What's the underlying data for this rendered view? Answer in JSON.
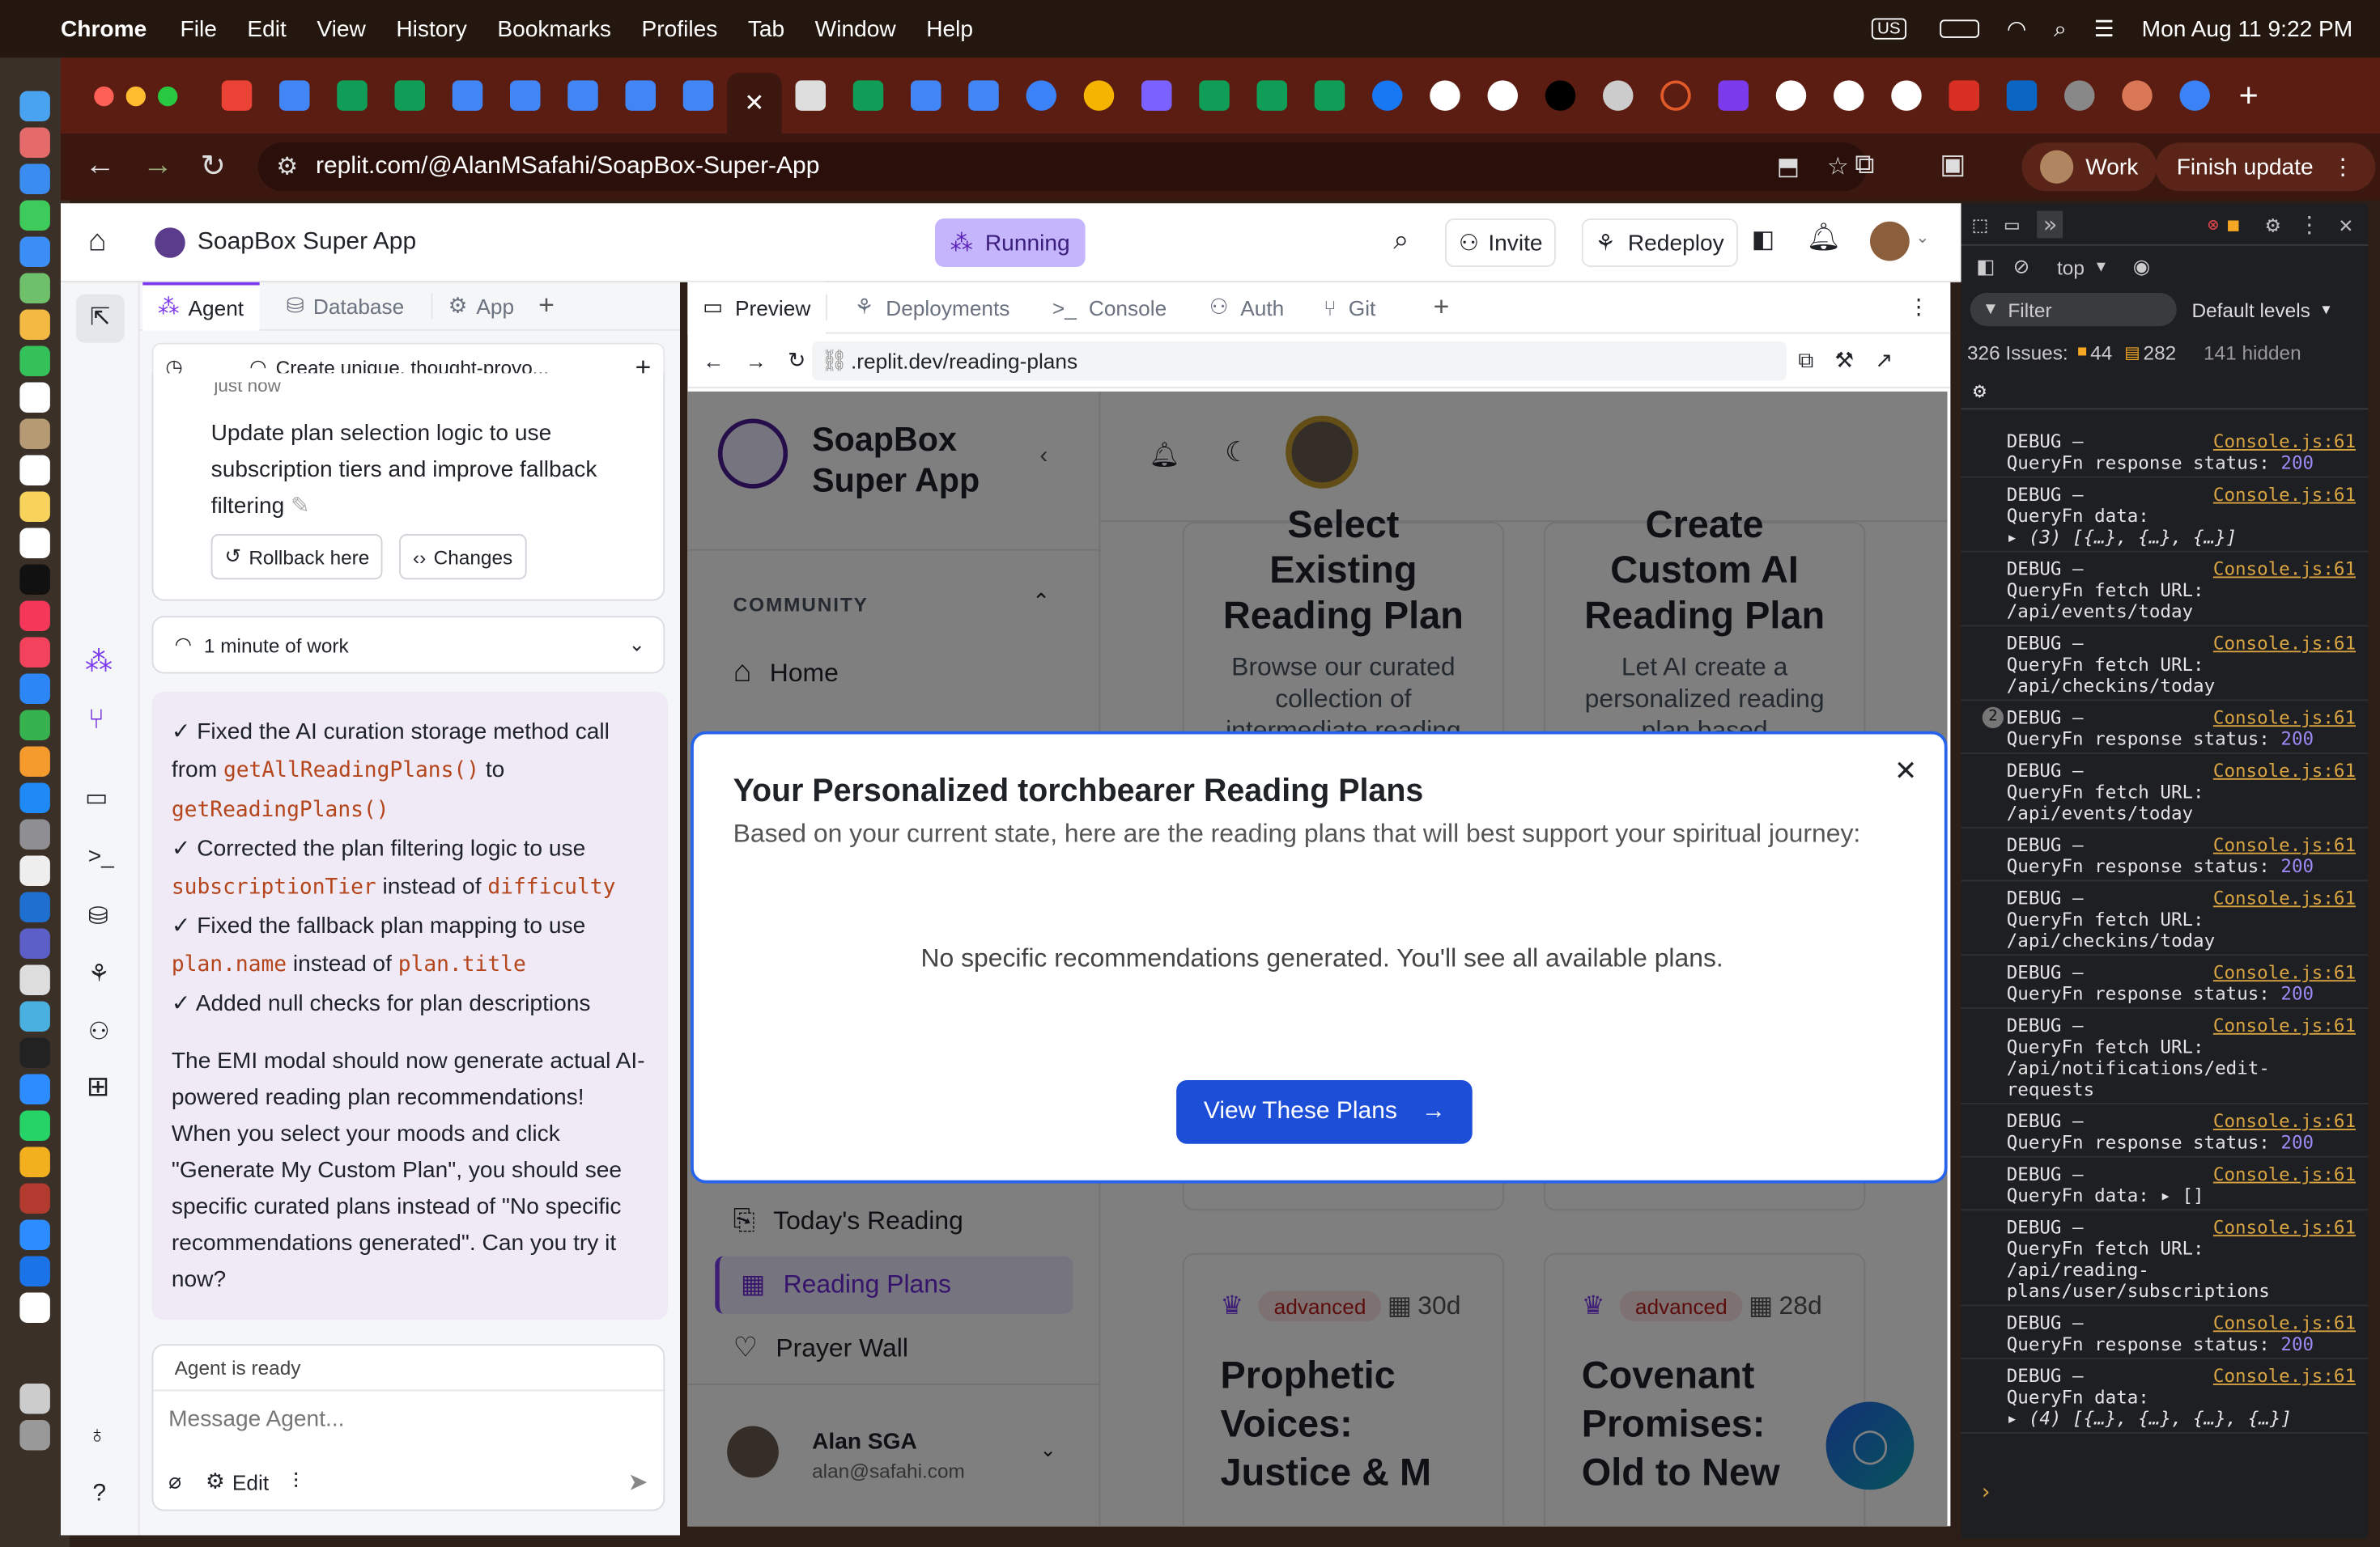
{
  "menubar": {
    "app": "Chrome",
    "items": [
      "File",
      "Edit",
      "View",
      "History",
      "Bookmarks",
      "Profiles",
      "Tab",
      "Window",
      "Help"
    ],
    "datetime": "Mon Aug 11  9:22 PM",
    "keyboard": "US"
  },
  "browser": {
    "url": "replit.com/@AlanMSafahi/SoapBox-Super-App",
    "profile": "Work",
    "update_btn": "Finish update"
  },
  "replit": {
    "project": "SoapBox Super App",
    "status": "Running",
    "invite": "Invite",
    "redeploy": "Redeploy",
    "left_tabs": [
      "Agent",
      "Database",
      "App"
    ],
    "right_tabs": [
      "Preview",
      "Deployments",
      "Console",
      "Auth",
      "Git"
    ]
  },
  "agent": {
    "history_title": "Create unique, thought-provo...",
    "time_hint": "just now",
    "checkpoint_text": "Update plan selection logic to use subscription tiers and improve fallback filtering",
    "rollback": "Rollback here",
    "changes": "Changes",
    "work_duration": "1 minute of work",
    "msg_l1a": "✓ Fixed the AI curation storage method call from ",
    "msg_c1": "getAllReadingPlans()",
    "msg_l1b": " to ",
    "msg_c2": "getReadingPlans()",
    "msg_l2a": "✓ Corrected the plan filtering logic to use ",
    "msg_c3": "subscriptionTier",
    "msg_l2b": " instead of ",
    "msg_c4": "difficulty",
    "msg_l3a": "✓ Fixed the fallback plan mapping to use ",
    "msg_c5": "plan.name",
    "msg_l3b": " instead of ",
    "msg_c6": "plan.title",
    "msg_l4": "✓ Added null checks for plan descriptions",
    "msg_body": "The EMI modal should now generate actual AI-powered reading plan recommendations! When you select your moods and click \"Generate My Custom Plan\", you should see specific curated plans instead of \"No specific recommendations generated\". Can you try it now?",
    "status": "Agent is ready",
    "placeholder": "Message Agent...",
    "edit": "Edit"
  },
  "preview": {
    "url": ".replit.dev/reading-plans",
    "app_name_1": "SoapBox",
    "app_name_2": "Super App",
    "section": "COMMUNITY",
    "nav_home": "Home",
    "nav_today": "Today's Reading",
    "nav_plans": "Reading Plans",
    "nav_prayer": "Prayer Wall",
    "user_name": "Alan SGA",
    "user_email": "alan@safahi.com",
    "card1_title_a": "Select",
    "card1_title_b": "Existing",
    "card1_title_c": "Reading Plan",
    "card1_desc": "Browse our curated collection of intermediate reading",
    "card2_title_a": "Create",
    "card2_title_b": "Custom AI",
    "card2_title_c": "Reading Plan",
    "card2_desc": "Let AI create a personalized reading plan based",
    "plan1_level": "advanced",
    "plan1_days": "30d",
    "plan1_title": "Prophetic Voices: Justice & M",
    "plan2_level": "advanced",
    "plan2_days": "28d",
    "plan2_title": "Covenant Promises: Old to New"
  },
  "modal": {
    "title": "Your Personalized torchbearer Reading Plans",
    "subtitle": "Based on your current state, here are the reading plans that will best support your spiritual journey:",
    "message": "No specific recommendations generated. You'll see all available plans.",
    "button": "View These Plans"
  },
  "devtools": {
    "context": "top",
    "filter": "Filter",
    "levels": "Default levels",
    "issues_label": "326 Issues:",
    "issues_warn": "44",
    "issues_info": "282",
    "hidden": "141 hidden",
    "source": "Console.js:61",
    "logs": [
      {
        "badge": "",
        "a": "DEBUG –",
        "b": "QueryFn response status:",
        "n": "200"
      },
      {
        "badge": "",
        "a": "DEBUG –",
        "b": "QueryFn data:",
        "n": "",
        "c": "▸ (3) [{…}, {…}, {…}]"
      },
      {
        "badge": "",
        "a": "DEBUG –",
        "b": "QueryFn fetch URL:",
        "n": "",
        "c": "/api/events/today"
      },
      {
        "badge": "",
        "a": "DEBUG –",
        "b": "QueryFn fetch URL:",
        "n": "",
        "c": "/api/checkins/today"
      },
      {
        "badge": "2",
        "a": "DEBUG –",
        "b": "QueryFn response status:",
        "n": "200"
      },
      {
        "badge": "",
        "a": "DEBUG –",
        "b": "QueryFn fetch URL:",
        "n": "",
        "c": "/api/events/today"
      },
      {
        "badge": "",
        "a": "DEBUG –",
        "b": "QueryFn response status:",
        "n": "200"
      },
      {
        "badge": "",
        "a": "DEBUG –",
        "b": "QueryFn fetch URL:",
        "n": "",
        "c": "/api/checkins/today"
      },
      {
        "badge": "",
        "a": "DEBUG –",
        "b": "QueryFn response status:",
        "n": "200"
      },
      {
        "badge": "",
        "a": "DEBUG –",
        "b": "QueryFn fetch URL:",
        "n": "",
        "c": "/api/notifications/edit-requests"
      },
      {
        "badge": "",
        "a": "DEBUG –",
        "b": "QueryFn response status:",
        "n": "200"
      },
      {
        "badge": "",
        "a": "DEBUG –",
        "b": "QueryFn data:  ▸ []",
        "n": ""
      },
      {
        "badge": "",
        "a": "DEBUG –",
        "b": "QueryFn fetch URL:",
        "n": "",
        "c": "/api/reading-plans/user/subscriptions"
      },
      {
        "badge": "",
        "a": "DEBUG –",
        "b": "QueryFn response status:",
        "n": "200"
      },
      {
        "badge": "",
        "a": "DEBUG –",
        "b": "QueryFn data:",
        "n": "",
        "c": "▸ (4) [{…}, {…}, {…}, {…}]"
      }
    ]
  },
  "colors": {
    "accent": "#1d4ed8",
    "running": "#c4b5fd",
    "agent_msg_bg": "#efeaf6",
    "devtools_bg": "#1e1f22"
  }
}
